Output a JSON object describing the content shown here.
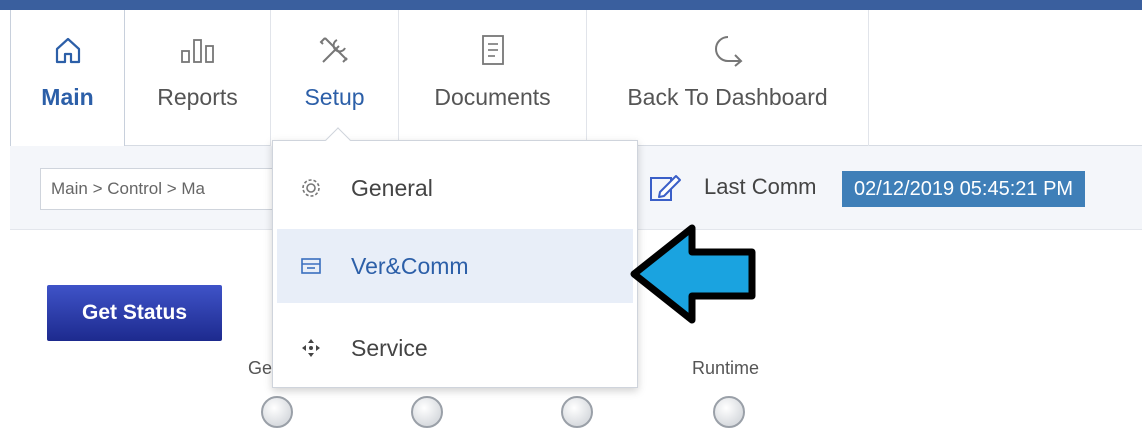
{
  "nav": {
    "tabs": [
      {
        "label": "Main",
        "icon": "home-icon"
      },
      {
        "label": "Reports",
        "icon": "bar-chart-icon"
      },
      {
        "label": "Setup",
        "icon": "tools-icon"
      },
      {
        "label": "Documents",
        "icon": "document-icon"
      },
      {
        "label": "Back To Dashboard",
        "icon": "back-arrow-icon"
      }
    ]
  },
  "subbar": {
    "breadcrumb": "Main > Control > Ma",
    "last_comm_label": "Last Comm",
    "last_comm_value": "02/12/2019 05:45:21 PM"
  },
  "content": {
    "get_status_label": "Get Status",
    "indicator_labels": [
      "Ge",
      "Runtime"
    ]
  },
  "setup_menu": {
    "items": [
      {
        "label": "General",
        "icon": "gear-icon"
      },
      {
        "label": "Ver&Comm",
        "icon": "card-icon",
        "highlighted": true
      },
      {
        "label": "Service",
        "icon": "move-icon"
      }
    ]
  },
  "colors": {
    "accent": "#2c5fa8",
    "top_rule": "#3a5f9e",
    "timestamp_bg": "#3f7fb8",
    "button_bg": "#2a3aa8",
    "arrow_fill": "#1aa3e0"
  }
}
